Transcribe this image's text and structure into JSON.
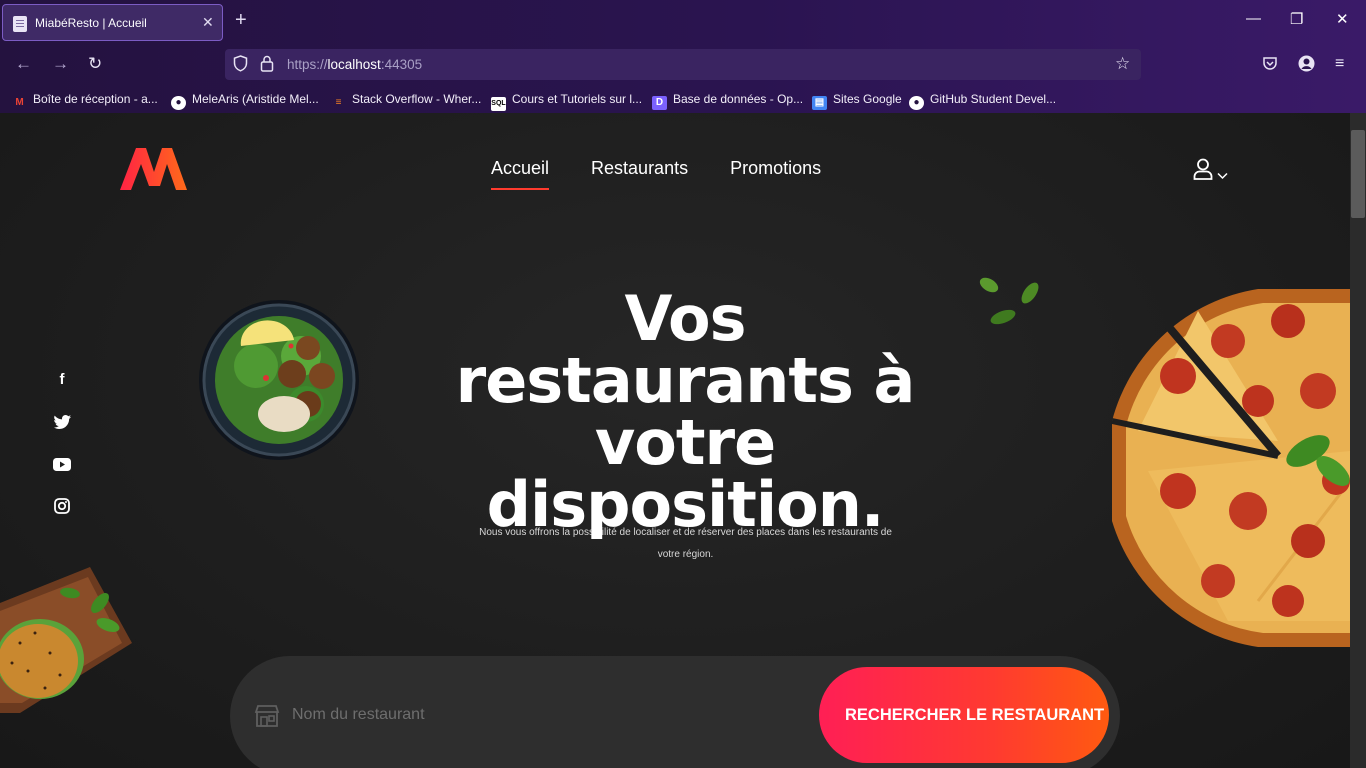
{
  "browser": {
    "tab_title": "MiabéResto | Accueil",
    "url_scheme": "https://",
    "url_host": "localhost",
    "url_port": ":44305",
    "bookmarks": [
      {
        "label": "Boîte de réception - a...",
        "icon": "gmail-icon",
        "color": "#ea4335"
      },
      {
        "label": "MeleAris (Aristide Mel...",
        "icon": "github-icon",
        "color": "#ffffff"
      },
      {
        "label": "Stack Overflow - Wher...",
        "icon": "stackoverflow-icon",
        "color": "#f48024"
      },
      {
        "label": "Cours et Tutoriels sur l...",
        "icon": "sql-icon",
        "color": "#ffffff"
      },
      {
        "label": "Base de données - Op...",
        "icon": "database-icon",
        "color": "#7b61ff"
      },
      {
        "label": "Sites Google",
        "icon": "google-sites-icon",
        "color": "#4285f4"
      },
      {
        "label": "GitHub Student Devel...",
        "icon": "github-icon",
        "color": "#ffffff"
      }
    ]
  },
  "header": {
    "nav": [
      "Accueil",
      "Restaurants",
      "Promotions"
    ],
    "active_nav": "Accueil"
  },
  "social": [
    "facebook-icon",
    "twitter-icon",
    "youtube-icon",
    "instagram-icon"
  ],
  "hero": {
    "title": "Vos restaurants à votre disposition.",
    "text": "Nous vous offrons la possibilité de localiser et de réserver des places dans les restaurants de votre région."
  },
  "search": {
    "placeholder": "Nom du restaurant",
    "button_label": "RECHERCHER LE RESTAURANT"
  },
  "colors": {
    "accent_start": "#ff1f55",
    "accent_end": "#ff5a10",
    "background": "#1e1e1e"
  }
}
